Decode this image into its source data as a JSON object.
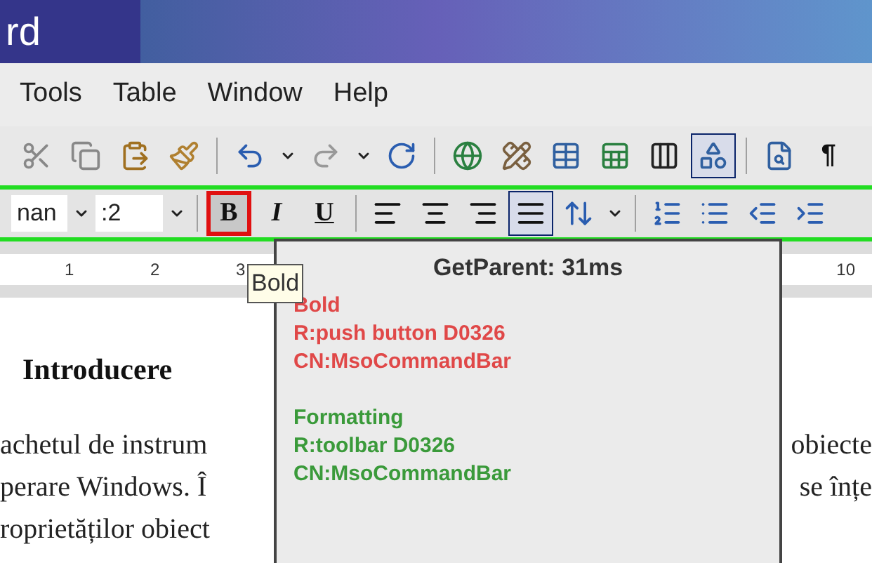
{
  "title_bar": {
    "title": "rd"
  },
  "menu_bar": [
    {
      "label": "Tools"
    },
    {
      "label": "Table"
    },
    {
      "label": "Window"
    },
    {
      "label": "Help"
    }
  ],
  "standard_toolbar": [
    {
      "kind": "cut",
      "selected": false
    },
    {
      "kind": "copy",
      "selected": false
    },
    {
      "kind": "paste",
      "selected": false
    },
    {
      "kind": "painter",
      "selected": false
    },
    {
      "kind": "sep"
    },
    {
      "kind": "undo",
      "selected": false
    },
    {
      "kind": "caret",
      "selected": false
    },
    {
      "kind": "redo",
      "selected": false
    },
    {
      "kind": "caret",
      "selected": false
    },
    {
      "kind": "refresh",
      "selected": false
    },
    {
      "kind": "sep"
    },
    {
      "kind": "link",
      "selected": false
    },
    {
      "kind": "draw_table",
      "selected": false
    },
    {
      "kind": "table",
      "selected": false
    },
    {
      "kind": "sheet",
      "selected": false
    },
    {
      "kind": "columns",
      "selected": false
    },
    {
      "kind": "drawing",
      "selected": true
    },
    {
      "kind": "sep"
    },
    {
      "kind": "map",
      "selected": false
    },
    {
      "kind": "text",
      "label": "¶",
      "selected": false
    }
  ],
  "formatting_toolbar": [
    {
      "kind": "font",
      "value": "nan"
    },
    {
      "kind": "caret",
      "selected": false
    },
    {
      "kind": "size",
      "value": ":2"
    },
    {
      "kind": "caret",
      "selected": false
    },
    {
      "kind": "sep"
    },
    {
      "kind": "bold",
      "label": "B",
      "selected": false,
      "highlighted": true
    },
    {
      "kind": "italic",
      "label": "I",
      "selected": false,
      "highlighted": false
    },
    {
      "kind": "underline",
      "label": "U",
      "selected": false,
      "highlighted": false
    },
    {
      "kind": "sep"
    },
    {
      "kind": "align_left",
      "selected": false
    },
    {
      "kind": "align_center",
      "selected": false
    },
    {
      "kind": "align_right",
      "selected": false
    },
    {
      "kind": "justify",
      "selected": true
    },
    {
      "kind": "spacing",
      "selected": false
    },
    {
      "kind": "caret",
      "selected": false
    },
    {
      "kind": "sep"
    },
    {
      "kind": "numbered",
      "selected": false
    },
    {
      "kind": "bullets",
      "selected": false
    },
    {
      "kind": "outdent",
      "selected": false
    },
    {
      "kind": "indent",
      "selected": false
    }
  ],
  "ruler": {
    "left_marks": [
      "1",
      "2",
      "3"
    ],
    "right_marks": [
      "10"
    ]
  },
  "tooltip": {
    "text": "Bold"
  },
  "document": {
    "heading": "Introducere",
    "lines": [
      {
        "left": "achetul de instrum",
        "right": "obiecte"
      },
      {
        "left": "perare Windows. Î",
        "right": "se înțe"
      },
      {
        "left": "roprietăților obiect"
      }
    ]
  },
  "inspector": {
    "header": "GetParent: 31ms",
    "groups": [
      {
        "color": "#e04848",
        "lines": [
          "Bold",
          "R:push button D0326",
          "CN:MsoCommandBar"
        ]
      },
      {
        "color": "#3a9a3a",
        "lines": [
          "Formatting",
          "R:toolbar D0326",
          "CN:MsoCommandBar"
        ]
      }
    ]
  }
}
